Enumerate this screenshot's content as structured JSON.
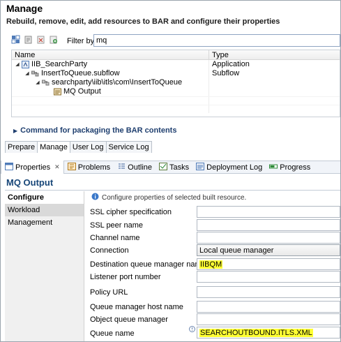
{
  "manage": {
    "title": "Manage",
    "subtitle": "Rebuild, remove, edit, add resources to BAR and configure their properties",
    "filter_label": "Filter by:",
    "filter_value": "mq",
    "columns": [
      "Name",
      "Type"
    ],
    "tree": [
      {
        "name": "IIB_SearchParty",
        "type": "Application",
        "icon": "application-icon",
        "level": 0
      },
      {
        "name": "InsertToQueue.subflow",
        "type": "Subflow",
        "icon": "subflow-icon",
        "level": 1
      },
      {
        "name": "searchparty\\iib\\itls\\com\\InsertToQueue",
        "type": "",
        "icon": "package-icon",
        "level": 2
      },
      {
        "name": "MQ Output",
        "type": "",
        "icon": "mq-output-icon",
        "level": 3
      }
    ],
    "command_link": "Command for packaging the BAR contents",
    "bottom_tabs": [
      "Prepare",
      "Manage",
      "User Log",
      "Service Log"
    ],
    "active_bottom_tab": "Manage"
  },
  "views": {
    "tabs": [
      "Properties",
      "Problems",
      "Outline",
      "Tasks",
      "Deployment Log",
      "Progress"
    ],
    "active": "Properties"
  },
  "properties": {
    "title": "MQ Output",
    "nav": [
      "Configure",
      "Workload Management"
    ],
    "info": "Configure properties of selected built resource.",
    "rows": [
      {
        "label": "SSL cipher specification",
        "value": ""
      },
      {
        "label": "SSL peer name",
        "value": ""
      },
      {
        "label": "Channel name",
        "value": ""
      },
      {
        "label": "Connection",
        "value": "Local queue manager"
      },
      {
        "label": "Destination queue manager name",
        "value": "IIBQM"
      },
      {
        "label": "Listener port number",
        "value": ""
      },
      {
        "label": "Policy URL",
        "value": ""
      },
      {
        "label": "Queue manager host name",
        "value": ""
      },
      {
        "label": "Object queue manager",
        "value": ""
      },
      {
        "label": "Queue name",
        "value": "SEARCHOUTBOUND.ITLS.XML"
      }
    ]
  },
  "colors": {
    "title_blue": "#174678",
    "highlight": "#ffff33",
    "link_blue": "#1f3f6f"
  }
}
